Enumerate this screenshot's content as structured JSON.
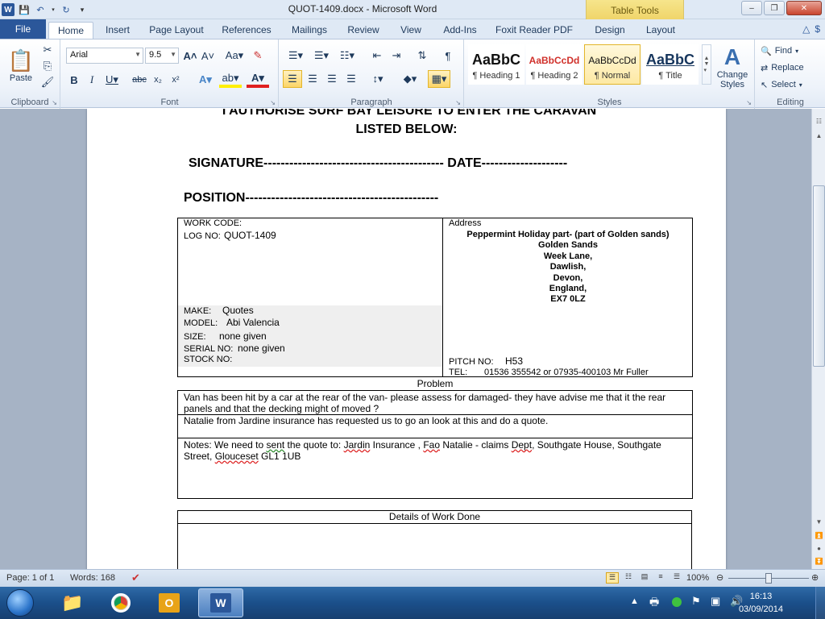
{
  "window": {
    "title": "QUOT-1409.docx  -  Microsoft Word",
    "contextual_tab_group": "Table Tools"
  },
  "tabs": [
    {
      "label": "File"
    },
    {
      "label": "Home"
    },
    {
      "label": "Insert"
    },
    {
      "label": "Page Layout"
    },
    {
      "label": "References"
    },
    {
      "label": "Mailings"
    },
    {
      "label": "Review"
    },
    {
      "label": "View"
    },
    {
      "label": "Add-Ins"
    },
    {
      "label": "Foxit Reader PDF"
    },
    {
      "label": "Design"
    },
    {
      "label": "Layout"
    }
  ],
  "ribbon": {
    "clipboard": {
      "label": "Clipboard",
      "paste_label": "Paste"
    },
    "font": {
      "label": "Font",
      "font_name": "Arial",
      "font_size": "9.5"
    },
    "paragraph": {
      "label": "Paragraph"
    },
    "styles": {
      "label": "Styles",
      "items": [
        {
          "sample": "AaBbC",
          "name": "¶ Heading 1"
        },
        {
          "sample": "AaBbCcDd",
          "name": "¶ Heading 2"
        },
        {
          "sample": "AaBbCcDd",
          "name": "¶ Normal"
        },
        {
          "sample": "AaBbC",
          "name": "¶ Title"
        }
      ],
      "change_styles_label": "Change Styles"
    },
    "editing": {
      "label": "Editing",
      "find_label": "Find",
      "replace_label": "Replace",
      "select_label": "Select"
    }
  },
  "document": {
    "authorise_line": "I AUTHORISE SURF BAY LEISURE TO ENTER THE CARAVAN",
    "listed_below": "LISTED BELOW:",
    "signature_line": "SIGNATURE------------------------------------------ DATE--------------------",
    "position_line": "POSITION---------------------------------------------",
    "work_code_label": "WORK CODE:",
    "log_no_label": "LOG NO:",
    "log_no_value": "QUOT-1409",
    "make_label": "MAKE:",
    "make_value": "Quotes",
    "model_label": "MODEL:",
    "model_value": "Abi Valencia",
    "size_label": "SIZE:",
    "size_value": "none given",
    "serial_label": "SERIAL NO:",
    "serial_value": "none given",
    "stock_label": "STOCK NO:",
    "address_label": "Address",
    "address_lines": [
      "Peppermint Holiday part- (part of Golden sands)",
      "Golden Sands",
      "Week Lane,",
      "Dawlish,",
      "Devon,",
      "England,",
      "EX7 0LZ"
    ],
    "pitch_label": "PITCH NO:",
    "pitch_value": "H53",
    "tel_label": "TEL:",
    "tel_value": "01536 355542  or 07935-400103  Mr Fuller",
    "problem_label": "Problem",
    "problem_1": "Van has been hit by a car at the rear of the van- please assess for damaged- they have advise me that it the rear panels and that the decking might of moved ?",
    "problem_2": "Natalie from Jardine insurance has requested us to go an look at this and do a quote.",
    "notes_prefix": "Notes: We need to ",
    "notes_sent": "sent",
    "notes_mid1": " the quote to: ",
    "notes_jardin": "Jardin",
    "notes_mid2": " Insurance , ",
    "notes_fao": "Fao",
    "notes_mid3": " Natalie - claims ",
    "notes_dept": "Dept",
    "notes_mid4": ", Southgate House, Southgate Street, ",
    "notes_glouc": "Glouceset",
    "notes_end": " GL1 1UB",
    "work_done_label": "Details of Work Done"
  },
  "statusbar": {
    "page": "Page: 1 of 1",
    "words": "Words: 168",
    "zoom": "100%"
  },
  "taskbar": {
    "time": "16:13",
    "date": "03/09/2014"
  },
  "colors": {
    "accent": "#2b579a",
    "contextual": "#f0d56a",
    "spelling": "#d22222"
  }
}
